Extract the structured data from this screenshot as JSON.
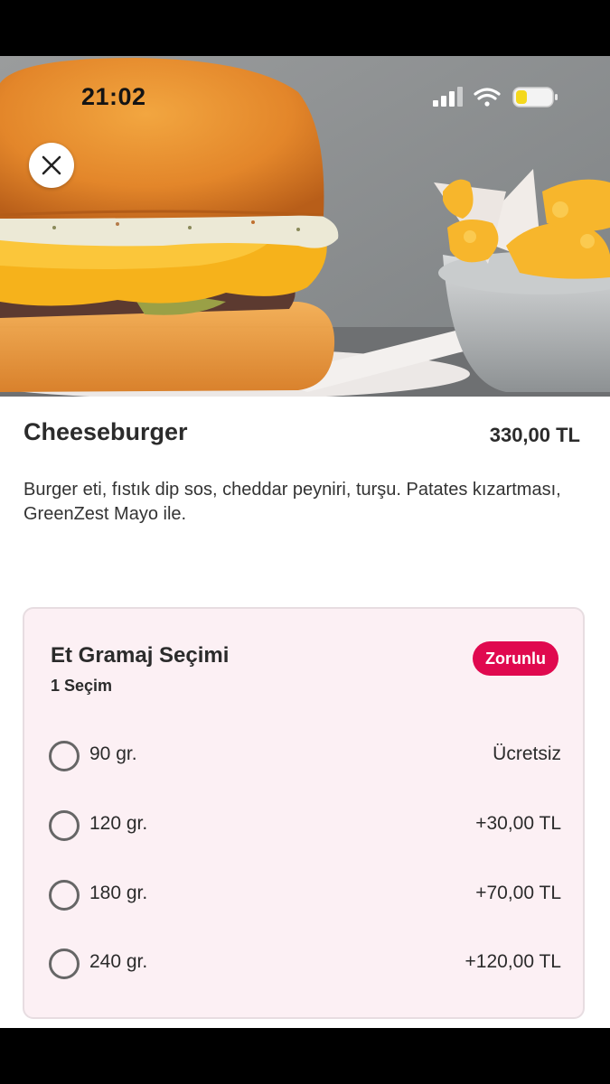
{
  "status_bar": {
    "time": "21:02"
  },
  "product": {
    "title": "Cheeseburger",
    "price": "330,00 TL",
    "description": "Burger eti, fıstık dip sos, cheddar peyniri, turşu. Patates kızartması, GreenZest Mayo ile."
  },
  "option_group": {
    "title": "Et Gramaj Seçimi",
    "subtitle": "1 Seçim",
    "badge": "Zorunlu",
    "options": [
      {
        "label": "90 gr.",
        "price": "Ücretsiz"
      },
      {
        "label": "120 gr.",
        "price": "+30,00 TL"
      },
      {
        "label": "180 gr.",
        "price": "+70,00 TL"
      },
      {
        "label": "240 gr.",
        "price": "+120,00 TL"
      }
    ]
  },
  "icons": {
    "close": "close-icon",
    "signal": "cellular-signal-icon",
    "wifi": "wifi-icon",
    "battery": "battery-low-icon"
  },
  "colors": {
    "accent": "#e0094f",
    "card_background": "#fcf0f4",
    "battery_fill": "#f4d81c"
  }
}
